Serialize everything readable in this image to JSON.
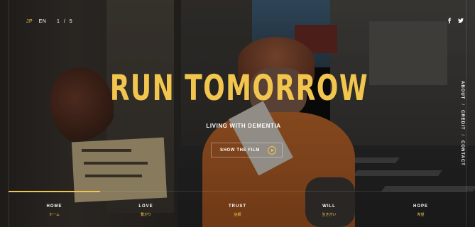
{
  "languages": [
    {
      "label": "JP",
      "active": true
    },
    {
      "label": "EN",
      "active": false
    }
  ],
  "slide_counter": "1 / 5",
  "social": {
    "facebook_icon": "facebook-icon",
    "twitter_icon": "twitter-icon"
  },
  "hero": {
    "title": "RUN TOMORROW",
    "subtitle": "LIVING WITH DEMENTIA",
    "button_label": "SHOW THE FILM",
    "button_icon": "play-icon"
  },
  "side_menu": [
    "ABOUT",
    "CREDIT",
    "CONTACT"
  ],
  "nav": [
    {
      "en": "HOME",
      "jp": "ホーム",
      "progress": 1.0
    },
    {
      "en": "LOVE",
      "jp": "繋がり",
      "progress": 0
    },
    {
      "en": "TRUST",
      "jp": "信頼",
      "progress": 0
    },
    {
      "en": "WILL",
      "jp": "生きがい",
      "progress": 0
    },
    {
      "en": "HOPE",
      "jp": "希望",
      "progress": 0
    }
  ],
  "colors": {
    "accent": "#f2c64e",
    "text": "#ffffff"
  }
}
